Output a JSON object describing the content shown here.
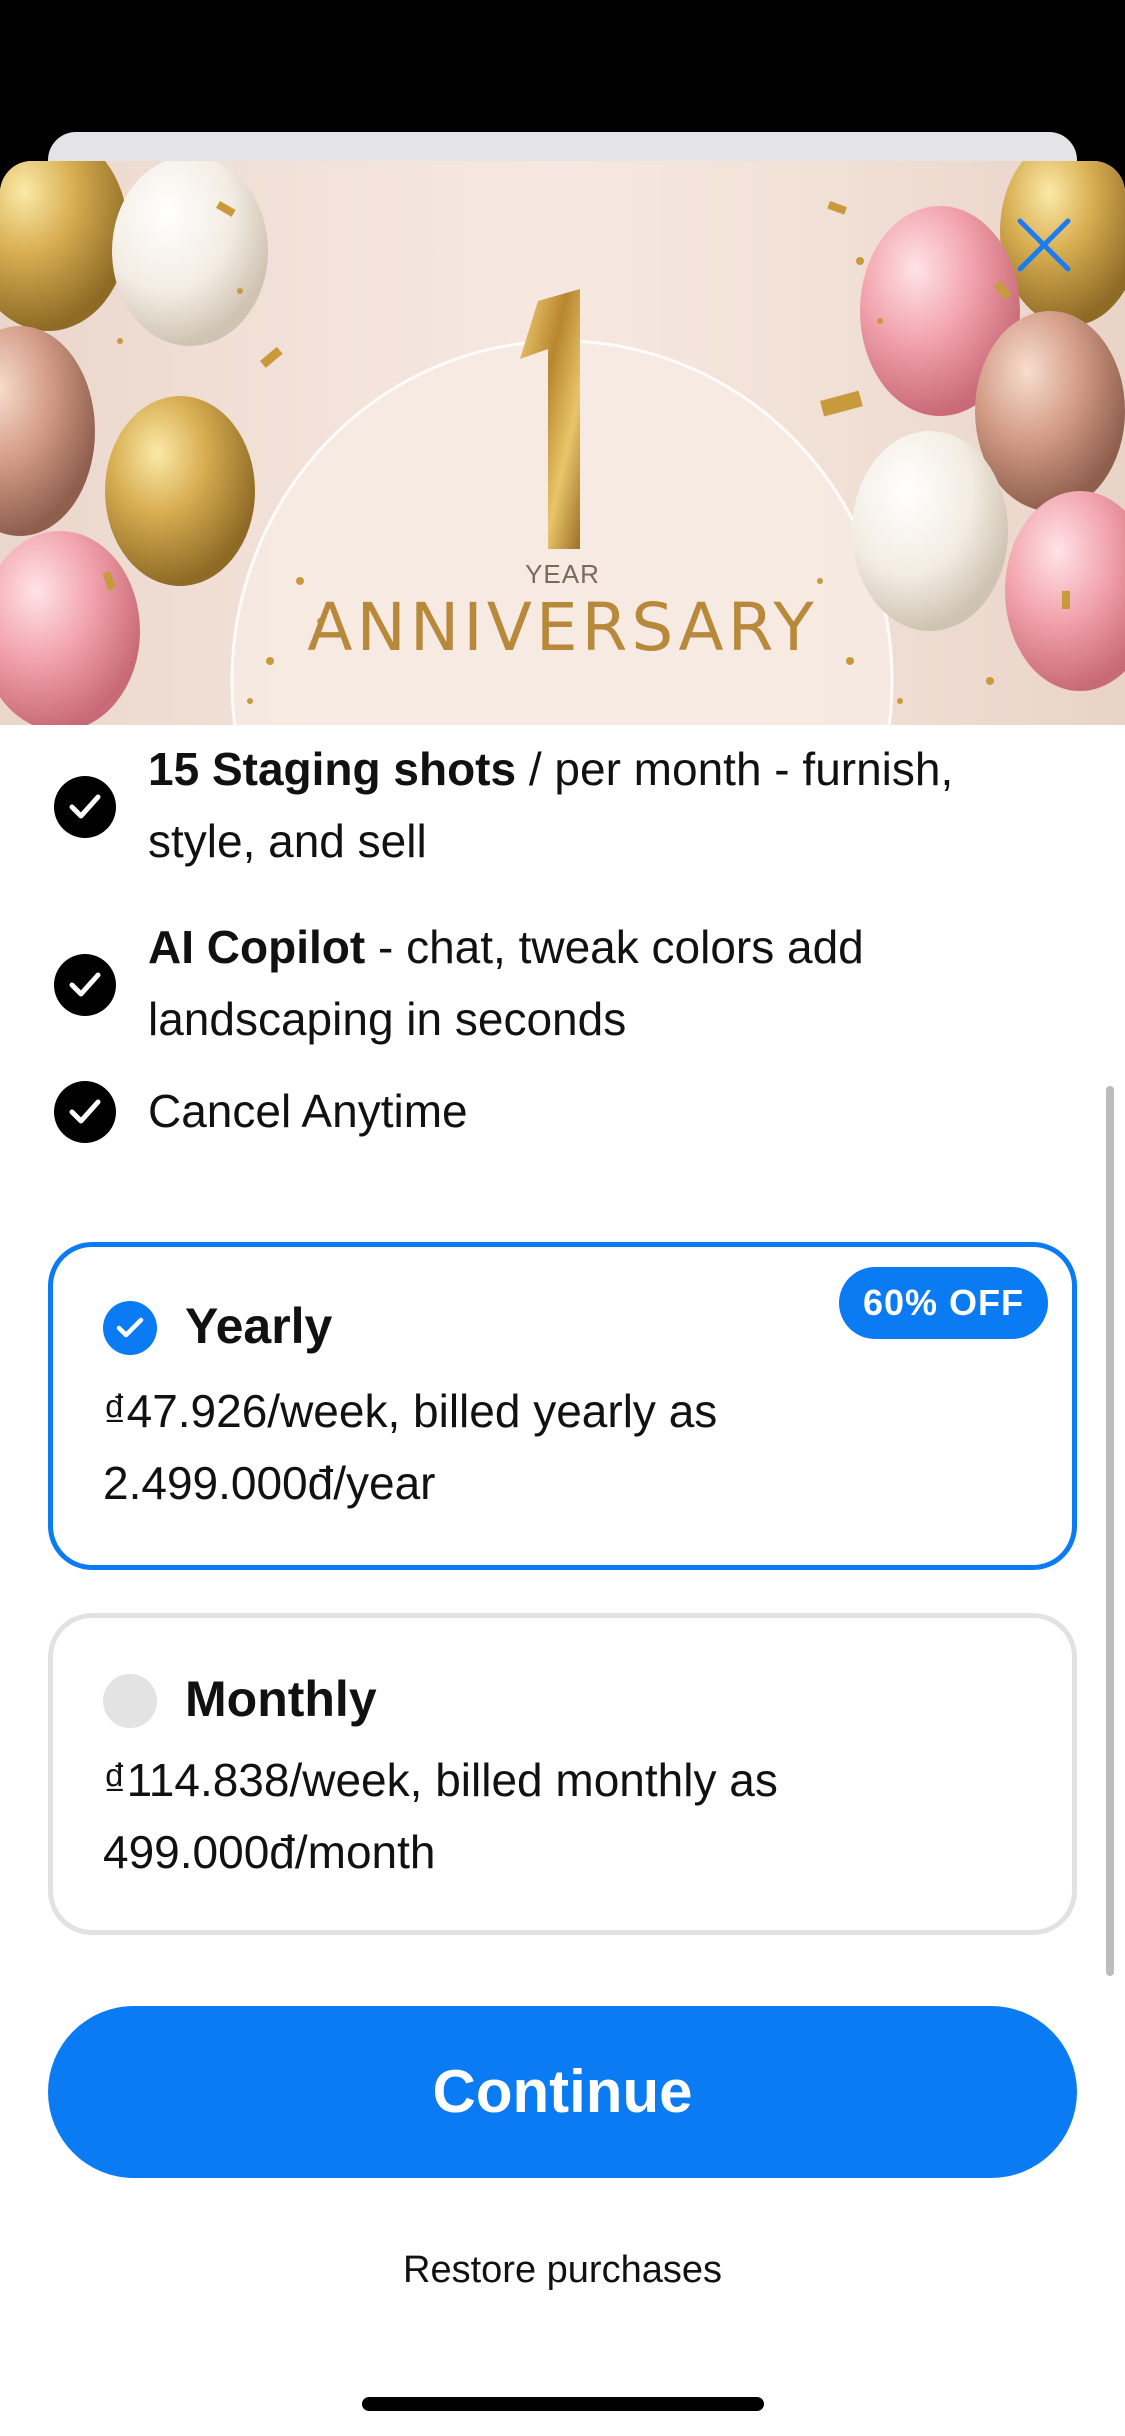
{
  "hero": {
    "number": "1",
    "year_label": "YEAR",
    "title": "ANNIVERSARY",
    "close_icon": "close-icon"
  },
  "features": [
    {
      "bold": "15 Staging shots",
      "rest_line1": " / per month - furnish,",
      "rest_line2": "style, and sell"
    },
    {
      "bold": "AI Copilot",
      "rest_line1": " - chat, tweak colors add",
      "rest_line2": "landscaping in seconds"
    },
    {
      "bold": "",
      "rest_line1": "Cancel Anytime",
      "rest_line2": ""
    }
  ],
  "plans": {
    "yearly": {
      "title": "Yearly",
      "badge": "60% OFF",
      "line1": "₫47.926/week, billed yearly as",
      "line2": "2.499.000đ/year",
      "selected": true
    },
    "monthly": {
      "title": "Monthly",
      "line1": "₫114.838/week, billed monthly as",
      "line2": "499.000đ/month",
      "selected": false
    }
  },
  "actions": {
    "continue_label": "Continue",
    "restore_label": "Restore purchases"
  },
  "colors": {
    "accent": "#0a7bf3",
    "gold": "#b8893a"
  }
}
